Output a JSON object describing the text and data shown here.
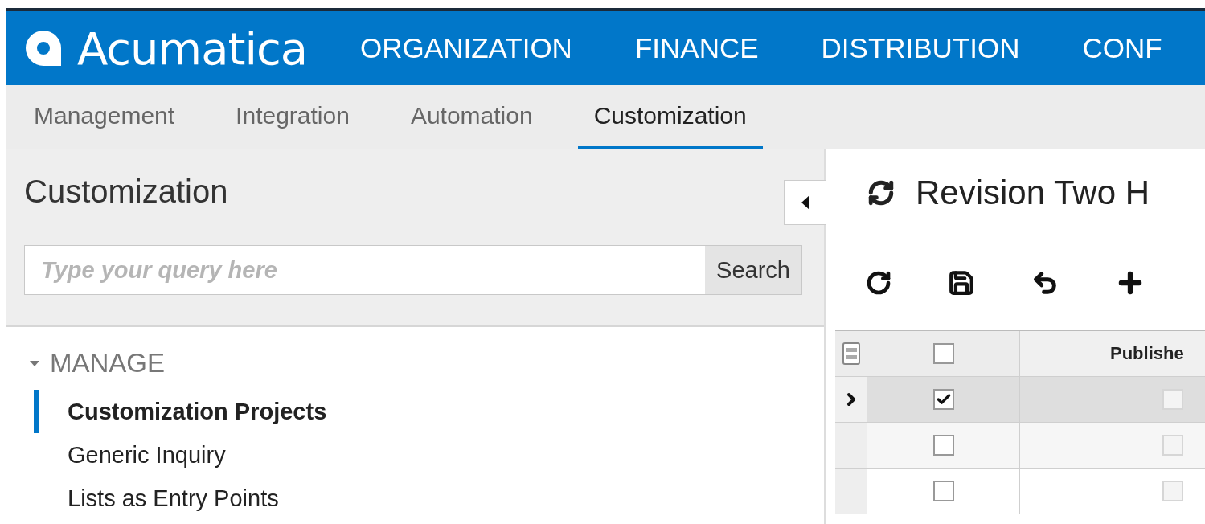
{
  "header": {
    "logo": "Acumatica",
    "nav": [
      "ORGANIZATION",
      "FINANCE",
      "DISTRIBUTION",
      "CONF"
    ]
  },
  "tabs": [
    {
      "label": "Management",
      "selected": false
    },
    {
      "label": "Integration",
      "selected": false
    },
    {
      "label": "Automation",
      "selected": false
    },
    {
      "label": "Customization",
      "selected": true
    }
  ],
  "sidebar": {
    "title": "Customization",
    "search": {
      "placeholder": "Type your query here",
      "button": "Search"
    },
    "groups": [
      {
        "label": "MANAGE",
        "expanded": true,
        "items": [
          {
            "label": "Customization Projects",
            "selected": true
          },
          {
            "label": "Generic Inquiry",
            "selected": false
          },
          {
            "label": "Lists as Entry Points",
            "selected": false
          }
        ]
      }
    ]
  },
  "form": {
    "title": "Revision Two H",
    "grid": {
      "columns": [
        "Publishe"
      ],
      "header_checked": false,
      "rows": [
        {
          "selected": true,
          "checked": true,
          "published": false
        },
        {
          "selected": false,
          "checked": false,
          "published": false
        },
        {
          "selected": false,
          "checked": false,
          "published": false
        }
      ]
    }
  }
}
